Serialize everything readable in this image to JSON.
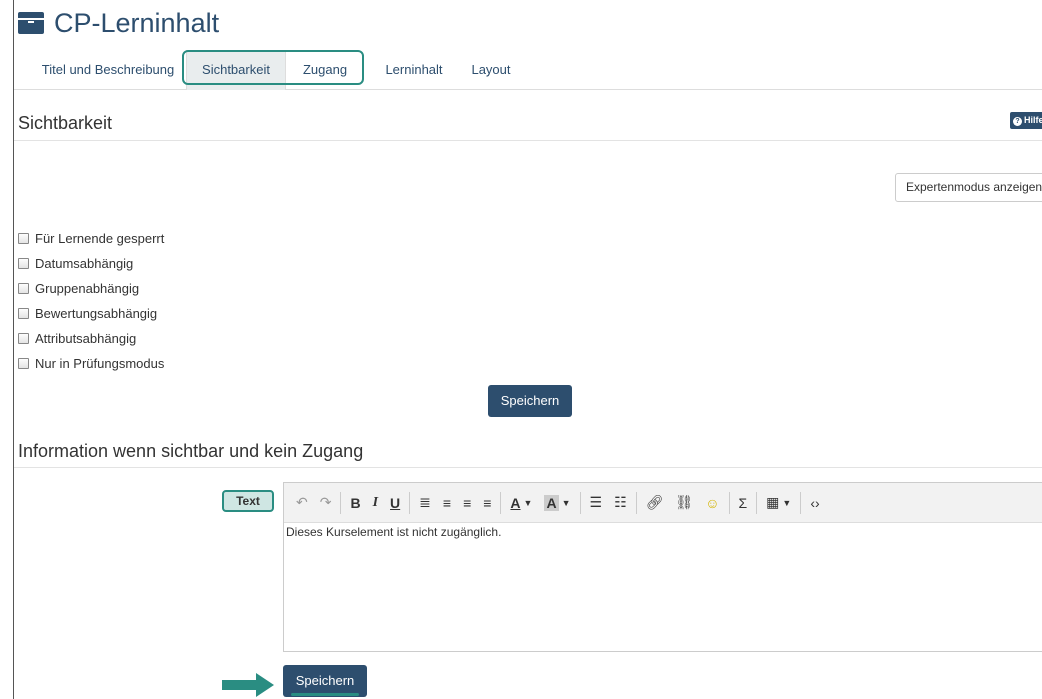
{
  "title": "CP-Lerninhalt",
  "tabs": [
    "Titel und Beschreibung",
    "Sichtbarkeit",
    "Zugang",
    "Lerninhalt",
    "Layout"
  ],
  "visibility": {
    "heading": "Sichtbarkeit",
    "help_label": "Hilfe",
    "expert_button": "Expertenmodus anzeigen",
    "checkboxes": [
      "Für Lernende gesperrt",
      "Datumsabhängig",
      "Gruppenabhängig",
      "Bewertungsabhängig",
      "Attributsabhängig",
      "Nur in Prüfungsmodus"
    ],
    "save_label": "Speichern"
  },
  "info": {
    "heading": "Information wenn sichtbar und kein Zugang",
    "text_label": "Text",
    "editor_content": "Dieses Kurselement ist nicht zugänglich.",
    "save_label": "Speichern"
  },
  "toolbar_icons": [
    "undo-icon",
    "redo-icon",
    "bold-icon",
    "italic-icon",
    "underline-icon",
    "align-justify-icon",
    "align-right-icon",
    "align-center-icon",
    "align-left-icon",
    "font-color-icon",
    "background-color-icon",
    "bullet-list-icon",
    "numbered-list-icon",
    "link-icon",
    "unlink-icon",
    "emoji-icon",
    "formula-icon",
    "table-icon",
    "source-code-icon"
  ],
  "colors": {
    "primary": "#2d4e6e",
    "highlight": "#2a8d82"
  }
}
